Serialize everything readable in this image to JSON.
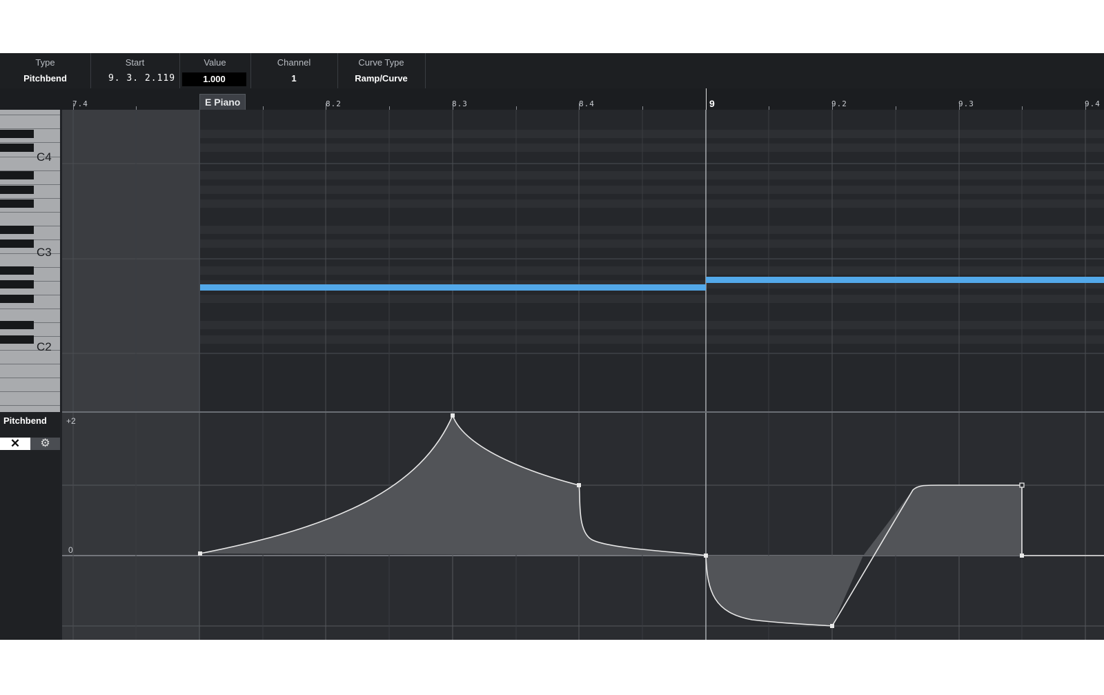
{
  "info_line": {
    "fields": [
      {
        "label": "Type",
        "value": "Pitchbend"
      },
      {
        "label": "Start",
        "value": "9. 3. 2.119"
      },
      {
        "label": "Value",
        "value": "1.000"
      },
      {
        "label": "Channel",
        "value": "1"
      },
      {
        "label": "Curve Type",
        "value": "Ramp/Curve"
      }
    ]
  },
  "ruler": {
    "labels": [
      "7.4",
      "8.2",
      "8.3",
      "8.4",
      "9",
      "9.2",
      "9.3",
      "9.4"
    ]
  },
  "part": {
    "name": "E Piano"
  },
  "keyboard": {
    "labels": [
      "C4",
      "C3",
      "C2"
    ]
  },
  "controller_lane": {
    "name": "Pitchbend",
    "close_icon": "close-icon",
    "settings_icon": "gear-icon",
    "axis_top": "+2",
    "axis_zero": "0"
  },
  "colors": {
    "note": "#53a9ea",
    "background": "#25272b",
    "curve": "#e8e8e8",
    "curve_fill": "#55575b"
  }
}
